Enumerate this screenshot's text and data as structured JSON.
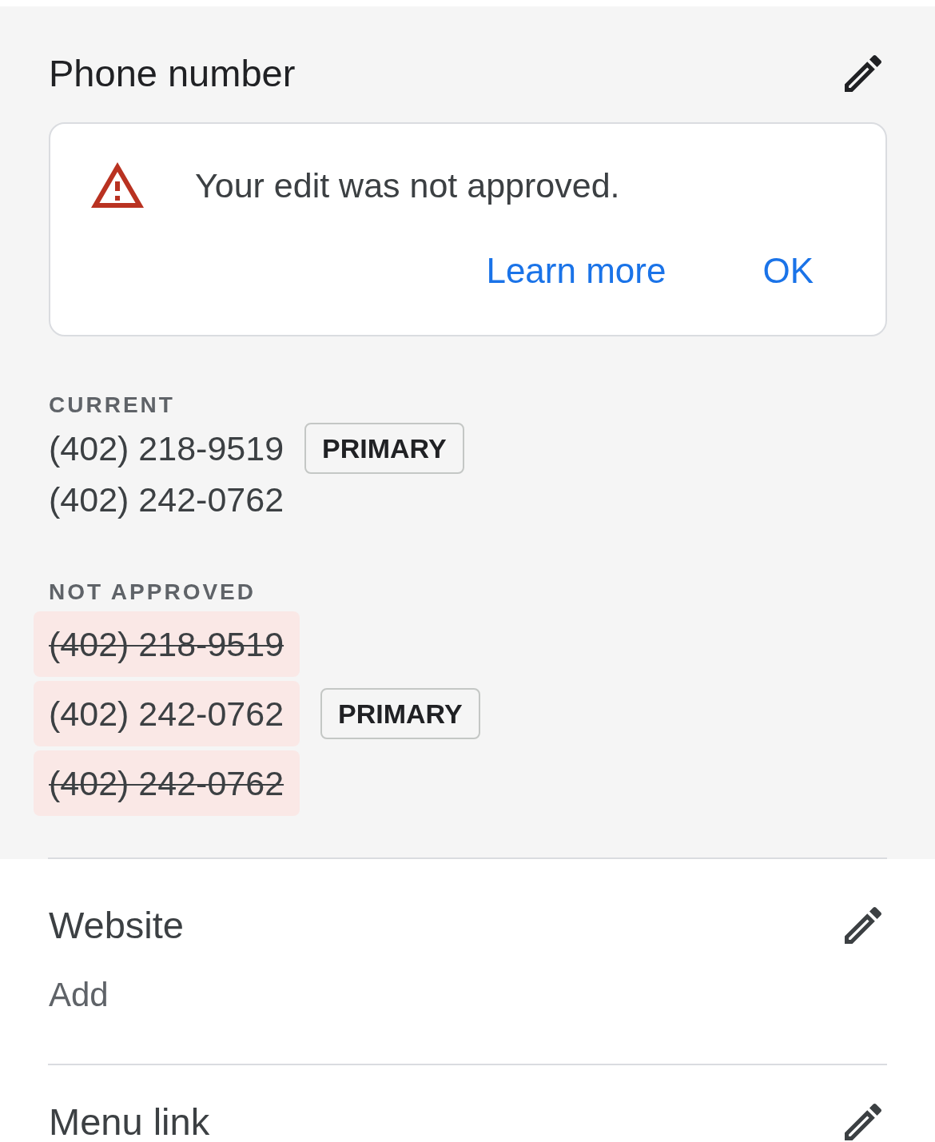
{
  "sections": [
    {
      "title": "Phone number",
      "highlighted": true,
      "notice": {
        "message": "Your edit was not approved.",
        "actions": [
          "Learn more",
          "OK"
        ]
      },
      "groups": [
        {
          "label": "CURRENT",
          "kind": "current",
          "numbers": [
            {
              "number": "(402) 218-9519",
              "struck_through": false,
              "badge": "PRIMARY"
            },
            {
              "number": "(402) 242-0762",
              "struck_through": false
            }
          ]
        },
        {
          "label": "NOT APPROVED",
          "kind": "rejected",
          "numbers": [
            {
              "number": "(402) 218-9519",
              "struck_through": true
            },
            {
              "number": "(402) 242-0762",
              "struck_through": false,
              "badge": "PRIMARY"
            },
            {
              "number": "(402) 242-0762",
              "struck_through": true
            }
          ]
        }
      ]
    },
    {
      "title": "Website",
      "highlighted": false,
      "value": "Add"
    },
    {
      "title": "Menu link",
      "highlighted": false
    }
  ]
}
